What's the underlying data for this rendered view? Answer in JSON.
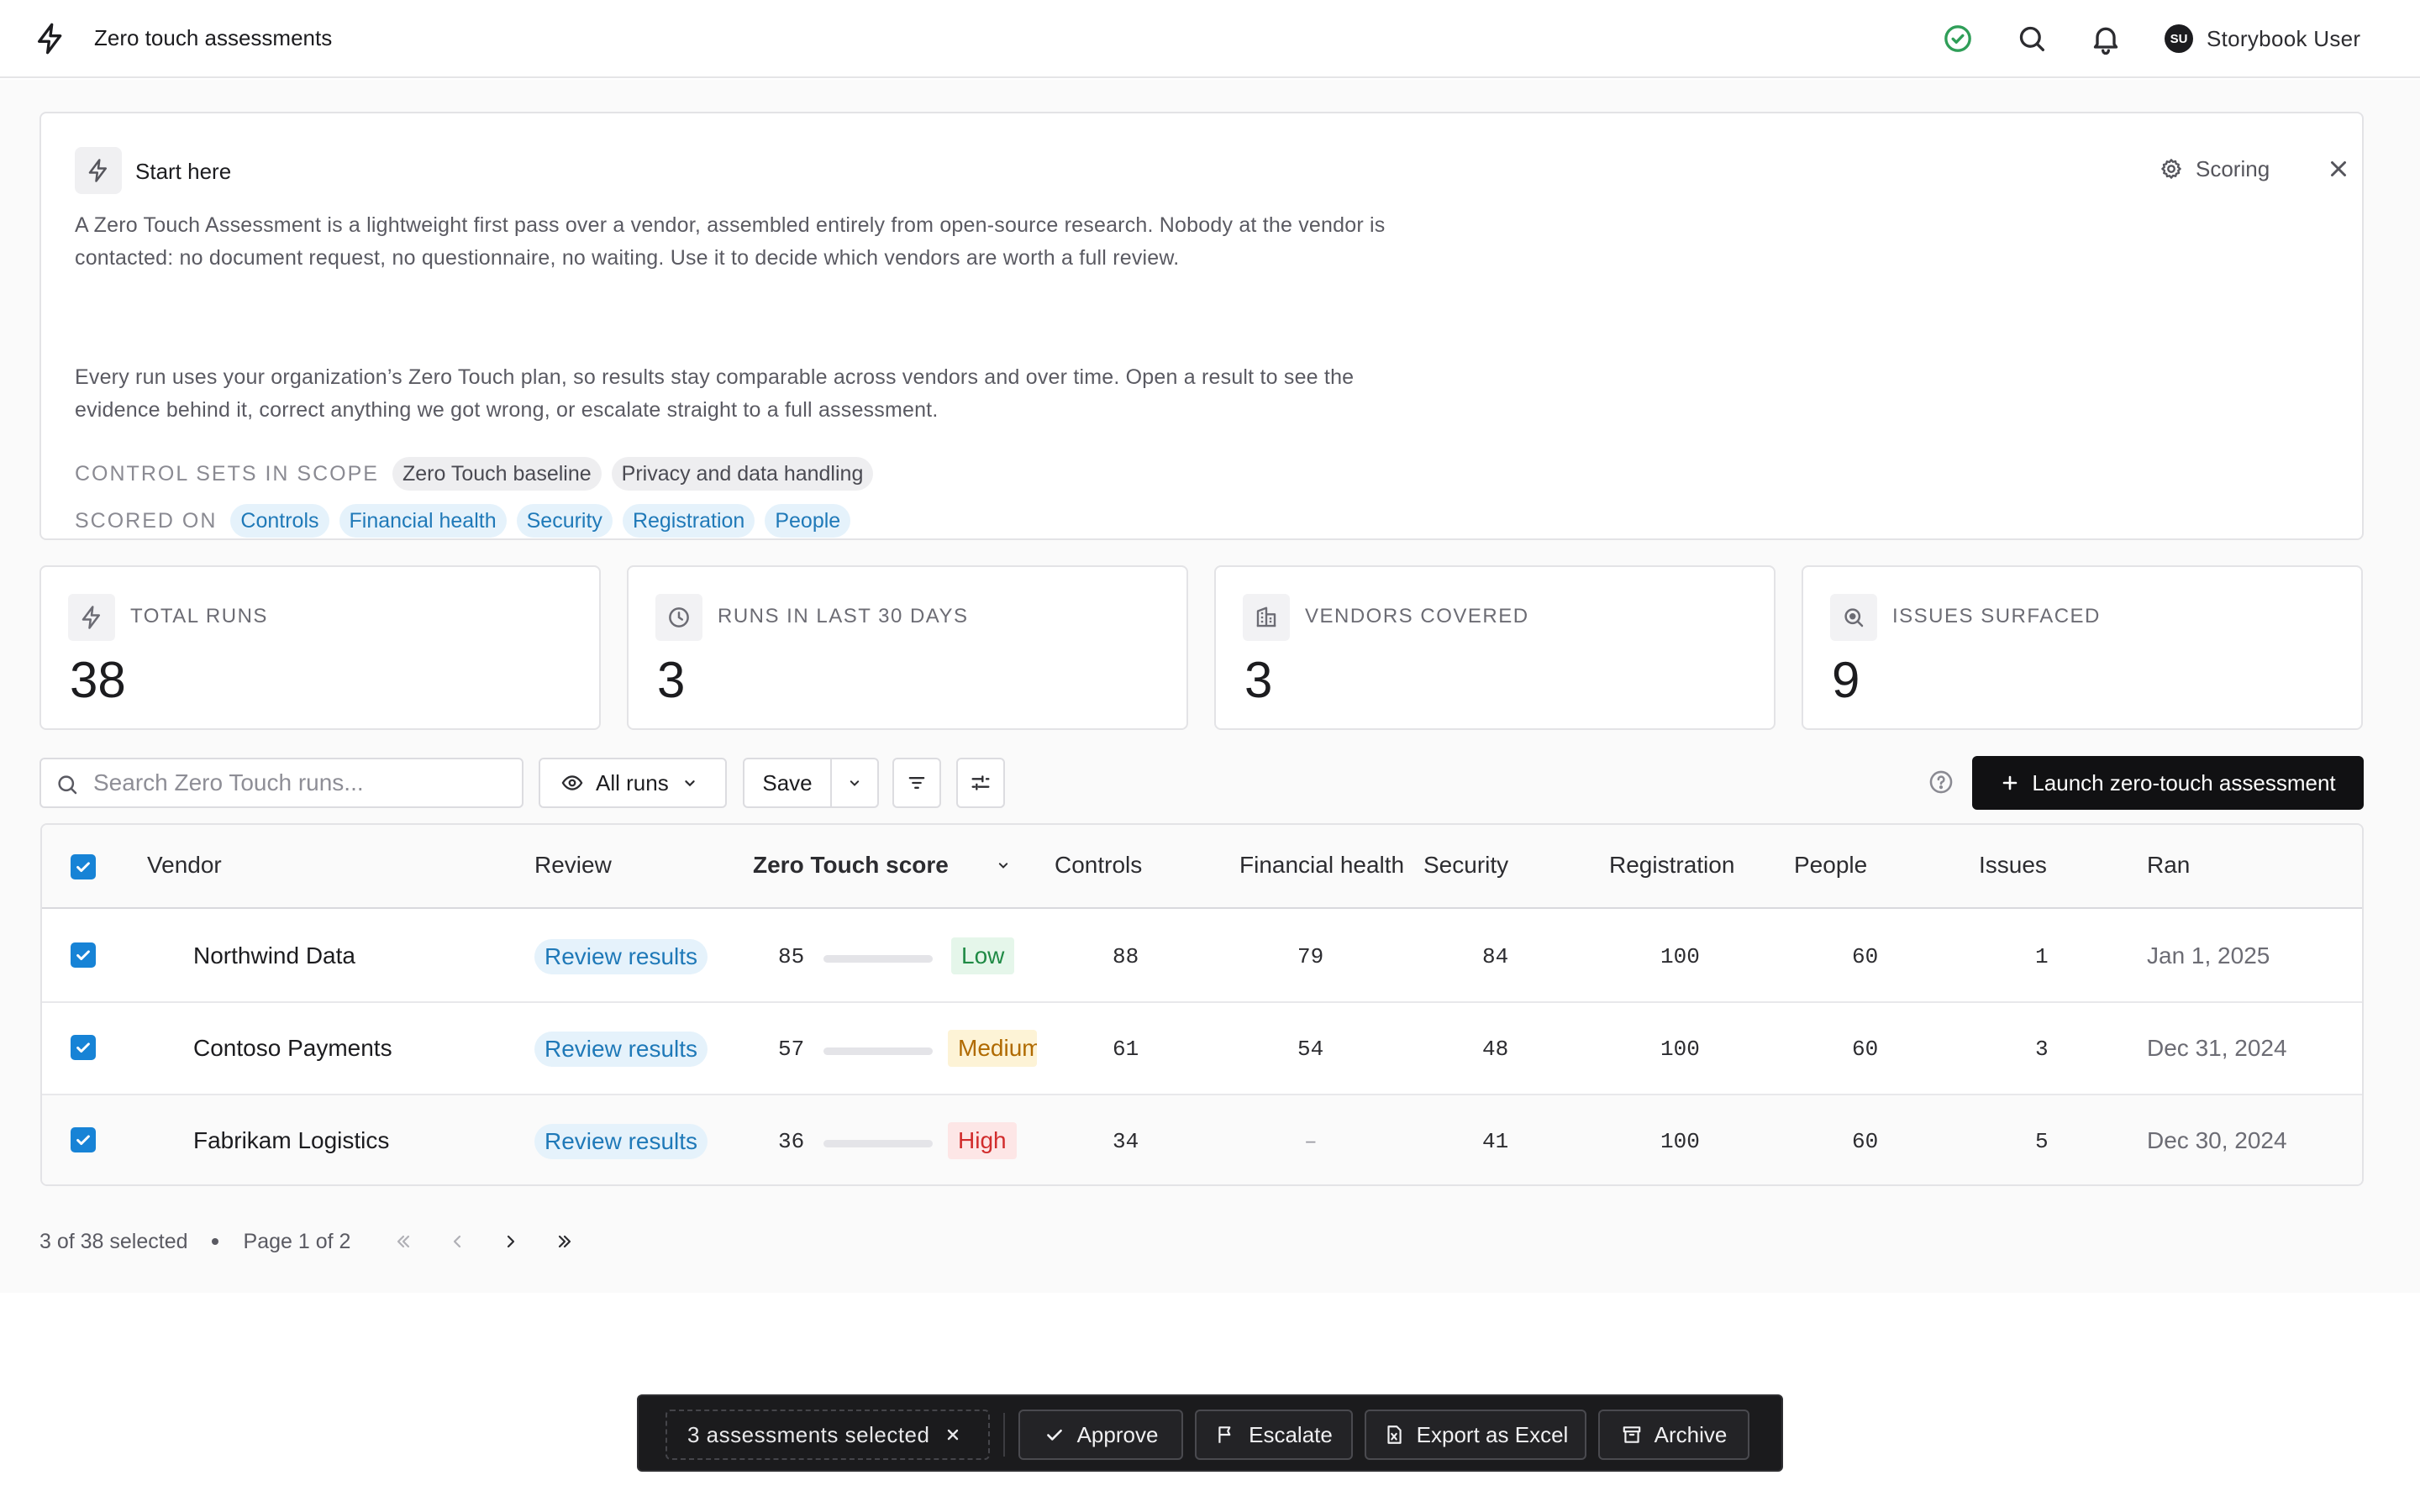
{
  "topbar": {
    "title": "Zero touch assessments",
    "user_initials": "SU",
    "user_name": "Storybook User",
    "icons": [
      "lightning-icon",
      "check-circle-icon",
      "search-icon",
      "bell-icon"
    ]
  },
  "intro": {
    "heading": "Start here",
    "scoring_label": "Scoring",
    "paragraph_1": "A Zero Touch Assessment is a lightweight first pass over a vendor, assembled entirely from open-source research. Nobody at the vendor is contacted: no document request, no questionnaire, no waiting. Use it to decide which vendors are worth a full review.",
    "paragraph_2": "Every run uses your organization’s Zero Touch plan, so results stay comparable across vendors and over time. Open a result to see the evidence behind it, correct anything we got wrong, or escalate straight to a full assessment.",
    "control_sets_label": "CONTROL SETS IN SCOPE",
    "control_sets": [
      "Zero Touch baseline",
      "Privacy and data handling"
    ],
    "scored_on_label": "SCORED ON",
    "scored_on": [
      "Controls",
      "Financial health",
      "Security",
      "Registration",
      "People"
    ]
  },
  "stats": [
    {
      "label": "TOTAL RUNS",
      "value": "38",
      "icon": "lightning-icon"
    },
    {
      "label": "RUNS IN LAST 30 DAYS",
      "value": "3",
      "icon": "clock-icon"
    },
    {
      "label": "VENDORS COVERED",
      "value": "3",
      "icon": "building-icon"
    },
    {
      "label": "ISSUES SURFACED",
      "value": "9",
      "icon": "search-issue-icon"
    }
  ],
  "toolbar": {
    "search_placeholder": "Search Zero Touch runs...",
    "view_label": "All runs",
    "save_label": "Save",
    "launch_label": "Launch zero-touch assessment"
  },
  "table": {
    "columns": [
      "Vendor",
      "Review",
      "Zero Touch score",
      "Controls",
      "Financial health",
      "Security",
      "Registration",
      "People",
      "Issues",
      "Ran"
    ],
    "rows": [
      {
        "vendor": "Northwind Data",
        "review": "Review results",
        "score": "85",
        "score_value": 85,
        "risk": "Low",
        "risk_level": "low",
        "controls": "88",
        "financial": "79",
        "security": "84",
        "registration": "100",
        "people": "60",
        "issues": "1",
        "ran": "Jan 1, 2025"
      },
      {
        "vendor": "Contoso Payments",
        "review": "Review results",
        "score": "57",
        "score_value": 57,
        "risk": "Medium",
        "risk_level": "medium",
        "controls": "61",
        "financial": "54",
        "security": "48",
        "registration": "100",
        "people": "60",
        "issues": "3",
        "ran": "Dec 31, 2024"
      },
      {
        "vendor": "Fabrikam Logistics",
        "review": "Review results",
        "score": "36",
        "score_value": 36,
        "risk": "High",
        "risk_level": "high",
        "controls": "34",
        "financial": "–",
        "security": "41",
        "registration": "100",
        "people": "60",
        "issues": "5",
        "ran": "Dec 30, 2024"
      }
    ]
  },
  "colors": {
    "low": "#2f9e58",
    "medium": "#f5c542",
    "high": "#e0393e",
    "accent": "#1783d6"
  },
  "pager": {
    "selection": "3 of 38 selected",
    "page": "Page 1 of 2"
  },
  "actionbar": {
    "selected": "3 assessments selected",
    "approve": "Approve",
    "escalate": "Escalate",
    "export": "Export as Excel",
    "archive": "Archive"
  }
}
